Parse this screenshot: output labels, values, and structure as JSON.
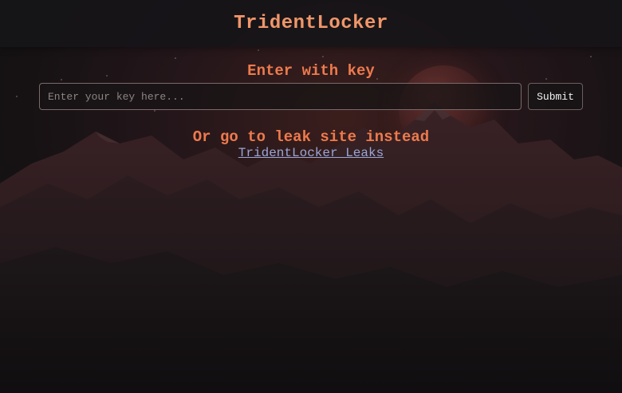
{
  "header": {
    "brand": "TridentLocker"
  },
  "key_form": {
    "label": "Enter with key",
    "input_placeholder": "Enter your key here...",
    "input_value": "",
    "submit_label": "Submit"
  },
  "leak_section": {
    "heading": "Or go to leak site instead",
    "link_text": "TridentLocker Leaks"
  },
  "colors": {
    "accent": "#ee7a4d",
    "brand": "#f0966a",
    "link": "#9aa6d8",
    "background": "#120f10"
  }
}
